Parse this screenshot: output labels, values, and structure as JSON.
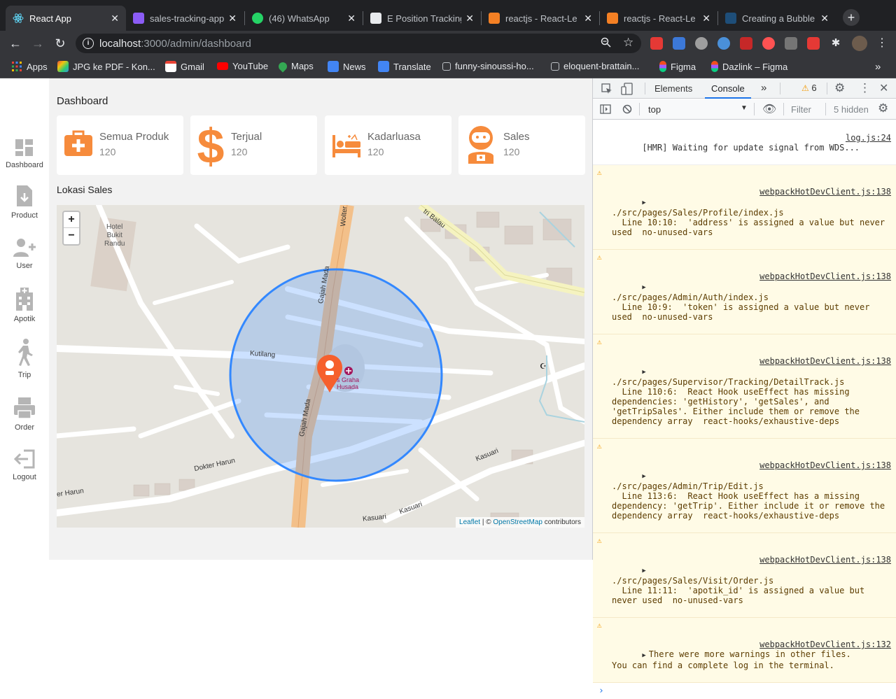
{
  "browser": {
    "tabs": [
      {
        "title": "React App",
        "fav_color": "#61dafb",
        "active": true
      },
      {
        "title": "sales-tracking-app",
        "fav_color": "#8b5cf6",
        "active": false
      },
      {
        "title": "(46) WhatsApp",
        "fav_color": "#25d366",
        "active": false
      },
      {
        "title": "E Position Tracking",
        "fav_color": "#e8eaed",
        "active": false
      },
      {
        "title": "reactjs - React-Le",
        "fav_color": "#f48024",
        "active": false
      },
      {
        "title": "reactjs - React-Le",
        "fav_color": "#f48024",
        "active": false
      },
      {
        "title": "Creating a Bubble",
        "fav_color": "#1e4e79",
        "active": false
      }
    ],
    "url_host": "localhost",
    "url_path": ":3000/admin/dashboard",
    "bookmarks": [
      {
        "label": "Apps",
        "icon": "apps-grid-icon",
        "color": "#4285f4"
      },
      {
        "label": "JPG ke PDF - Kon...",
        "icon": "ilovepdf-icon",
        "color": "#e74c3c"
      },
      {
        "label": "Gmail",
        "icon": "gmail-icon",
        "color": "#ea4335"
      },
      {
        "label": "YouTube",
        "icon": "youtube-icon",
        "color": "#ff0000"
      },
      {
        "label": "Maps",
        "icon": "maps-icon",
        "color": "#34a853"
      },
      {
        "label": "News",
        "icon": "news-icon",
        "color": "#4285f4"
      },
      {
        "label": "Translate",
        "icon": "translate-icon",
        "color": "#4285f4"
      },
      {
        "label": "funny-sinoussi-ho...",
        "icon": "cube-icon",
        "color": "#bdc1c6"
      },
      {
        "label": "eloquent-brattain...",
        "icon": "cube-icon",
        "color": "#bdc1c6"
      },
      {
        "label": "Figma",
        "icon": "figma-icon",
        "color": "#f24e1e"
      },
      {
        "label": "Dazlink – Figma",
        "icon": "figma-icon",
        "color": "#a259ff"
      }
    ],
    "bookmarks_more": "»"
  },
  "sidebar": {
    "items": [
      {
        "label": "Dashboard",
        "icon": "dashboard-icon"
      },
      {
        "label": "Product",
        "icon": "product-icon"
      },
      {
        "label": "User",
        "icon": "user-add-icon"
      },
      {
        "label": "Apotik",
        "icon": "hospital-icon"
      },
      {
        "label": "Trip",
        "icon": "walking-icon"
      },
      {
        "label": "Order",
        "icon": "printer-icon"
      },
      {
        "label": "Logout",
        "icon": "logout-icon"
      }
    ]
  },
  "dashboard": {
    "title": "Dashboard",
    "accent_color": "#f68b3c",
    "cards": [
      {
        "label": "Semua Produk",
        "value": "120",
        "icon": "medkit-icon"
      },
      {
        "label": "Terjual",
        "value": "120",
        "icon": "dollar-icon"
      },
      {
        "label": "Kadarluasa",
        "value": "120",
        "icon": "hospital-bed-icon"
      },
      {
        "label": "Sales",
        "value": "120",
        "icon": "astronaut-icon"
      }
    ],
    "map_section_title": "Lokasi Sales"
  },
  "map": {
    "zoom_in": "+",
    "zoom_out": "−",
    "labels": {
      "hotel": "Hotel\nBukit\nRandu",
      "gajah_mada_1": "Gajah Mada",
      "gajah_mada_2": "Gajah Mada",
      "kutilang": "Kutilang",
      "dokter_harun": "Dokter Harun",
      "er_harun": "er Harun",
      "kasuari_1": "Kasuari",
      "kasuari_2": "Kasuari",
      "kasuari_3": "Kasuari",
      "tri_balau": "tri Balau",
      "hospital": "s Graha\nHusada",
      "top_road": "Wolter M"
    },
    "attribution_leaflet": "Leaflet",
    "attribution_mid": " | © ",
    "attribution_osm": "OpenStreetMap",
    "attribution_end": " contributors",
    "circle_color": "#3388ff",
    "marker_color": "#f6602d"
  },
  "devtools": {
    "tabs": [
      "Elements",
      "Console"
    ],
    "active_tab": "Console",
    "more": "»",
    "warning_count": "6",
    "context": "top",
    "filter_placeholder": "Filter",
    "hidden_text": "5 hidden",
    "messages": [
      {
        "type": "info",
        "text": "[HMR] Waiting for update signal from WDS...",
        "source": "log.js:24"
      },
      {
        "type": "warn",
        "text": "./src/pages/Sales/Profile/index.js\n  Line 10:10:  'address' is assigned a value but never used  no-unused-vars",
        "source": "webpackHotDevClient.js:138"
      },
      {
        "type": "warn",
        "text": "./src/pages/Admin/Auth/index.js\n  Line 10:9:  'token' is assigned a value but never used  no-unused-vars",
        "source": "webpackHotDevClient.js:138"
      },
      {
        "type": "warn",
        "text": "./src/pages/Supervisor/Tracking/DetailTrack.js\n  Line 110:6:  React Hook useEffect has missing dependencies: 'getHistory', 'getSales', and 'getTripSales'. Either include them or remove the dependency array  react-hooks/exhaustive-deps",
        "source": "webpackHotDevClient.js:138"
      },
      {
        "type": "warn",
        "text": "./src/pages/Admin/Trip/Edit.js\n  Line 113:6:  React Hook useEffect has a missing dependency: 'getTrip'. Either include it or remove the dependency array  react-hooks/exhaustive-deps",
        "source": "webpackHotDevClient.js:138"
      },
      {
        "type": "warn",
        "text": "./src/pages/Sales/Visit/Order.js\n  Line 11:11:  'apotik_id' is assigned a value but never used  no-unused-vars",
        "source": "webpackHotDevClient.js:138"
      },
      {
        "type": "warn",
        "text": "There were more warnings in other files.\nYou can find a complete log in the terminal.",
        "source": "webpackHotDevClient.js:132"
      }
    ],
    "prompt": "›"
  }
}
